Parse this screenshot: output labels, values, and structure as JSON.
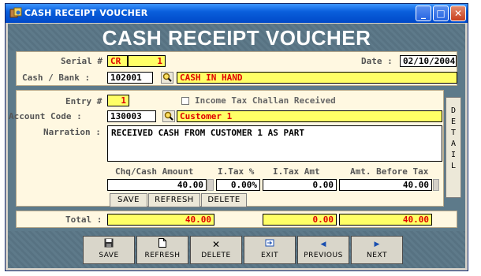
{
  "window": {
    "title": "CASH RECEIPT VOUCHER",
    "minimize": "_",
    "maximize": "□",
    "close": "✕"
  },
  "header": {
    "title": "CASH RECEIPT VOUCHER"
  },
  "form": {
    "serial_label": "Serial #",
    "serial_prefix": "CR",
    "serial_no": "1",
    "date_label": "Date :",
    "date_value": "02/10/2004",
    "cash_bank_label": "Cash / Bank :",
    "cash_bank_code": "102001",
    "cash_bank_name": "CASH IN HAND",
    "entry_label": "Entry #",
    "entry_no": "1",
    "income_tax_label": "Income Tax Challan Received",
    "income_tax_checked": false,
    "account_code_label": "Account Code :",
    "account_code": "130003",
    "account_name": "Customer 1",
    "narration_label": "Narration :",
    "narration_text": "RECEIVED CASH FROM CUSTOMER 1 AS PART",
    "detail_letters": [
      "D",
      "E",
      "T",
      "A",
      "I",
      "L"
    ]
  },
  "grid": {
    "headers": {
      "amount": "Chq/Cash Amount",
      "itax_pct": "I.Tax %",
      "itax_amt": "I.Tax Amt",
      "before_tax": "Amt. Before Tax"
    },
    "values": {
      "amount": "40.00",
      "itax_pct": "0.00%",
      "itax_amt": "0.00",
      "before_tax": "40.00"
    },
    "buttons": {
      "save": "SAVE",
      "refresh": "REFRESH",
      "delete": "DELETE"
    }
  },
  "totals": {
    "label": "Total :",
    "amount": "40.00",
    "itax_amt": "0.00",
    "before_tax": "40.00"
  },
  "toolbar": {
    "save": "SAVE",
    "refresh": "REFRESH",
    "delete": "DELETE",
    "exit": "EXIT",
    "previous": "PREVIOUS",
    "next": "NEXT"
  },
  "colors": {
    "accent_yellow": "#ffff66",
    "value_red": "#e00000",
    "panel_bg": "#fff8e1",
    "chrome_slate": "#5d7a8a"
  }
}
